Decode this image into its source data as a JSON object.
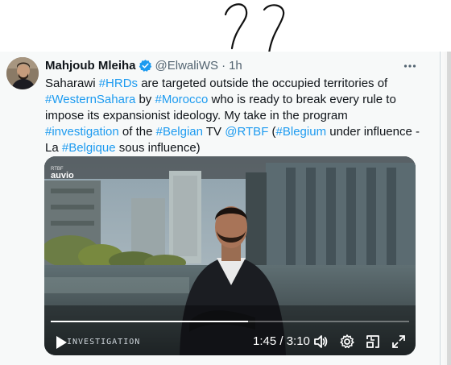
{
  "tweet": {
    "author_name": "Mahjoub Mleiha",
    "handle": "@ElwaliWS",
    "separator": "·",
    "time": "1h",
    "text_segments": [
      {
        "text": "Saharawi ",
        "link": false
      },
      {
        "text": "#HRDs",
        "link": true
      },
      {
        "text": " are targeted outside the occupied territories of ",
        "link": false
      },
      {
        "text": "#WesternSahara",
        "link": true
      },
      {
        "text": " by ",
        "link": false
      },
      {
        "text": "#Morocco",
        "link": true
      },
      {
        "text": " who is ready to break every rule to impose its expansionist ideology. My take in the program ",
        "link": false
      },
      {
        "text": "#investigation",
        "link": true
      },
      {
        "text": " of the ",
        "link": false
      },
      {
        "text": "#Belgian",
        "link": true
      },
      {
        "text": " TV ",
        "link": false
      },
      {
        "text": "@RTBF",
        "link": true
      },
      {
        "text": " (",
        "link": false
      },
      {
        "text": "#Blegium",
        "link": true
      },
      {
        "text": " under influence - La ",
        "link": false
      },
      {
        "text": "#Belgique",
        "link": true
      },
      {
        "text": " sous influence)",
        "link": false
      }
    ]
  },
  "video": {
    "timecode": "1:45 / 3:10",
    "progress": 0.55,
    "logo_text": "auvio",
    "chyron": "INVESTIGATION"
  },
  "icons": {
    "verified": "verified-badge-icon",
    "more": "more-icon",
    "play": "play-icon",
    "volume": "volume-icon",
    "settings": "gear-icon",
    "pip": "picture-in-picture-icon",
    "fullscreen": "fullscreen-icon"
  },
  "colors": {
    "link": "#1d9bf0",
    "text": "#0f1419",
    "muted": "#536471",
    "background": "#f7f9f9"
  }
}
